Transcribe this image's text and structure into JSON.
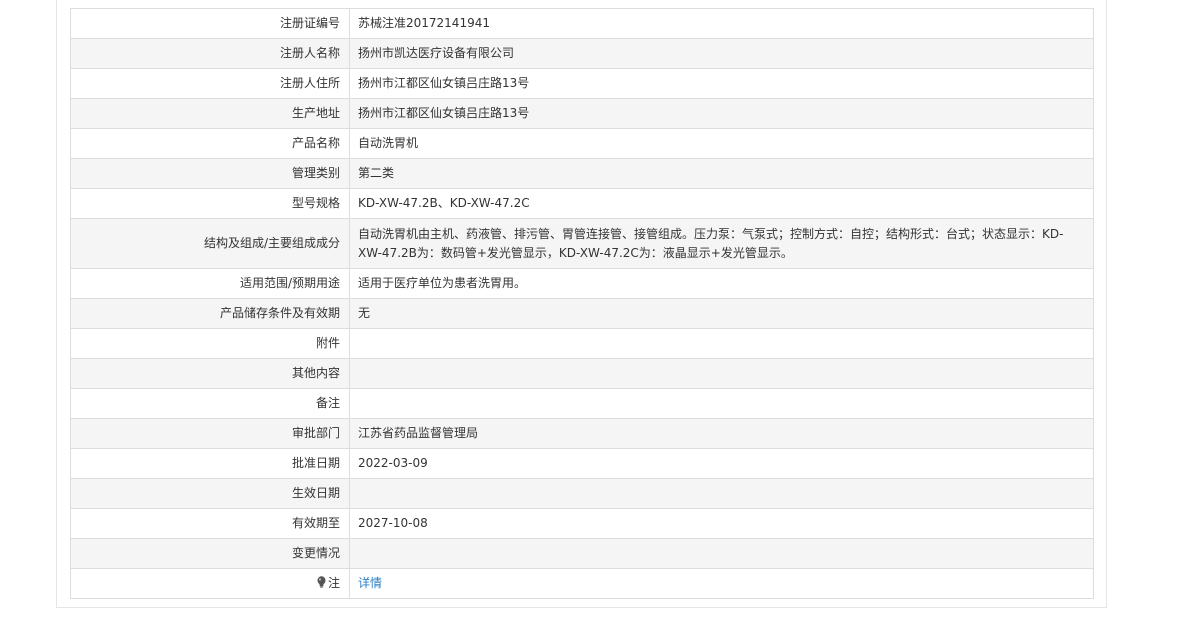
{
  "rows": [
    {
      "label": "注册证编号",
      "value": "苏械注准20172141941"
    },
    {
      "label": "注册人名称",
      "value": "扬州市凯达医疗设备有限公司"
    },
    {
      "label": "注册人住所",
      "value": "扬州市江都区仙女镇吕庄路13号"
    },
    {
      "label": "生产地址",
      "value": "扬州市江都区仙女镇吕庄路13号"
    },
    {
      "label": "产品名称",
      "value": "自动洗胃机"
    },
    {
      "label": "管理类别",
      "value": "第二类"
    },
    {
      "label": "型号规格",
      "value": "KD-XW-47.2B、KD-XW-47.2C"
    },
    {
      "label": "结构及组成/主要组成成分",
      "value": "自动洗胃机由主机、药液管、排污管、胃管连接管、接管组成。压力泵：气泵式；控制方式：自控；结构形式：台式；状态显示：KD-XW-47.2B为：数码管+发光管显示，KD-XW-47.2C为：液晶显示+发光管显示。"
    },
    {
      "label": "适用范围/预期用途",
      "value": "适用于医疗单位为患者洗胃用。"
    },
    {
      "label": "产品储存条件及有效期",
      "value": "无"
    },
    {
      "label": "附件",
      "value": ""
    },
    {
      "label": "其他内容",
      "value": ""
    },
    {
      "label": "备注",
      "value": ""
    },
    {
      "label": "审批部门",
      "value": "江苏省药品监督管理局"
    },
    {
      "label": "批准日期",
      "value": "2022-03-09"
    },
    {
      "label": "生效日期",
      "value": ""
    },
    {
      "label": "有效期至",
      "value": "2027-10-08"
    },
    {
      "label": "变更情况",
      "value": ""
    }
  ],
  "note_row": {
    "icon": "lightbulb-icon",
    "label": "注",
    "link_text": "详情"
  },
  "colors": {
    "link": "#2a7fc4",
    "stripe": "#f5f5f5",
    "border": "#dddddd"
  }
}
